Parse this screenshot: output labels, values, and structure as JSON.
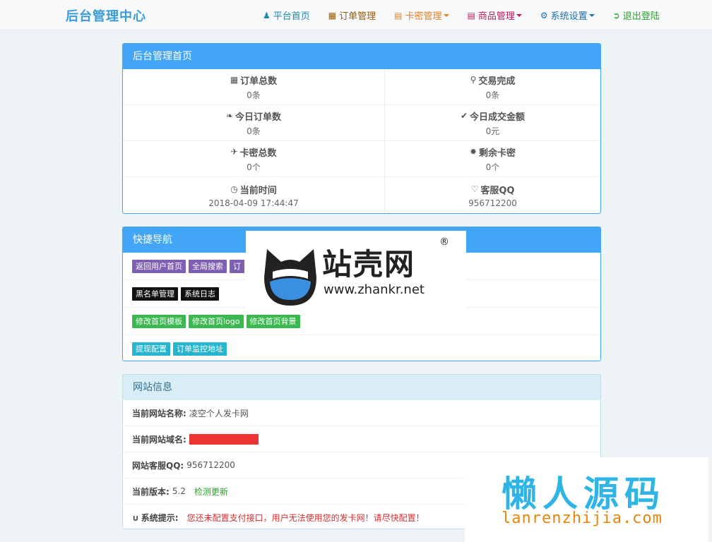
{
  "navbar": {
    "brand": "后台管理中心",
    "items": [
      {
        "label": "平台首页",
        "color": "#1e88a8",
        "icon": "user-icon",
        "dropdown": false
      },
      {
        "label": "订单管理",
        "color": "#9a5a00",
        "icon": "calendar-icon",
        "dropdown": false
      },
      {
        "label": "卡密管理",
        "color": "#e67e22",
        "icon": "list-icon",
        "dropdown": true
      },
      {
        "label": "商品管理",
        "color": "#c2185b",
        "icon": "list-alt-icon",
        "dropdown": true
      },
      {
        "label": "系统设置",
        "color": "#1f6fa5",
        "icon": "gear-icon",
        "dropdown": true
      },
      {
        "label": "退出登陆",
        "color": "#2e9e2e",
        "icon": "logout-icon",
        "dropdown": false
      }
    ]
  },
  "dashboard": {
    "title": "后台管理首页",
    "stats": [
      {
        "label": "订单总数",
        "value": "0条",
        "icon": "grid-icon"
      },
      {
        "label": "交易完成",
        "value": "0条",
        "icon": "cart-icon"
      },
      {
        "label": "今日订单数",
        "value": "0条",
        "icon": "leaf-icon"
      },
      {
        "label": "今日成交金额",
        "value": "0元",
        "icon": "check-icon"
      },
      {
        "label": "卡密总数",
        "value": "0个",
        "icon": "plane-icon"
      },
      {
        "label": "剩余卡密",
        "value": "0个",
        "icon": "certificate-icon"
      },
      {
        "label": "当前时间",
        "value": "2018-04-09 17:44:47",
        "icon": "clock-icon"
      },
      {
        "label": "客服QQ",
        "value": "956712200",
        "icon": "heart-icon"
      }
    ]
  },
  "quicknav": {
    "title": "快捷导航",
    "rows": [
      [
        {
          "label": "返回用户首页",
          "style": "purple"
        },
        {
          "label": "全局搜索",
          "style": "purple"
        },
        {
          "label": "订",
          "style": "purple"
        }
      ],
      [
        {
          "label": "黑名单管理",
          "style": "black"
        },
        {
          "label": "系统日志",
          "style": "black"
        }
      ],
      [
        {
          "label": "修改首页模板",
          "style": "green"
        },
        {
          "label": "修改首页logo",
          "style": "green"
        },
        {
          "label": "修改首页背景",
          "style": "green"
        }
      ],
      [
        {
          "label": "提现配置",
          "style": "cyan"
        },
        {
          "label": "订单监控地址",
          "style": "cyan"
        }
      ]
    ]
  },
  "siteinfo": {
    "title": "网站信息",
    "name_label": "当前网站名称:",
    "name_value": "凌空个人发卡网",
    "domain_label": "当前网站域名:",
    "qq_label": "网站客服QQ:",
    "qq_value": "956712200",
    "version_label": "当前版本:",
    "version_value": "5.2",
    "update_link": "检测更新",
    "tip_label": "系统提示:",
    "tip_text": "您还未配置支付接口，用户无法使用您的发卡网！请尽快配置！"
  },
  "watermark1": {
    "text": "站壳网",
    "url": "www.zhankr.net",
    "reg": "®"
  },
  "watermark2": {
    "text": "懒人源码",
    "url": "lanrenzhijia.com"
  }
}
